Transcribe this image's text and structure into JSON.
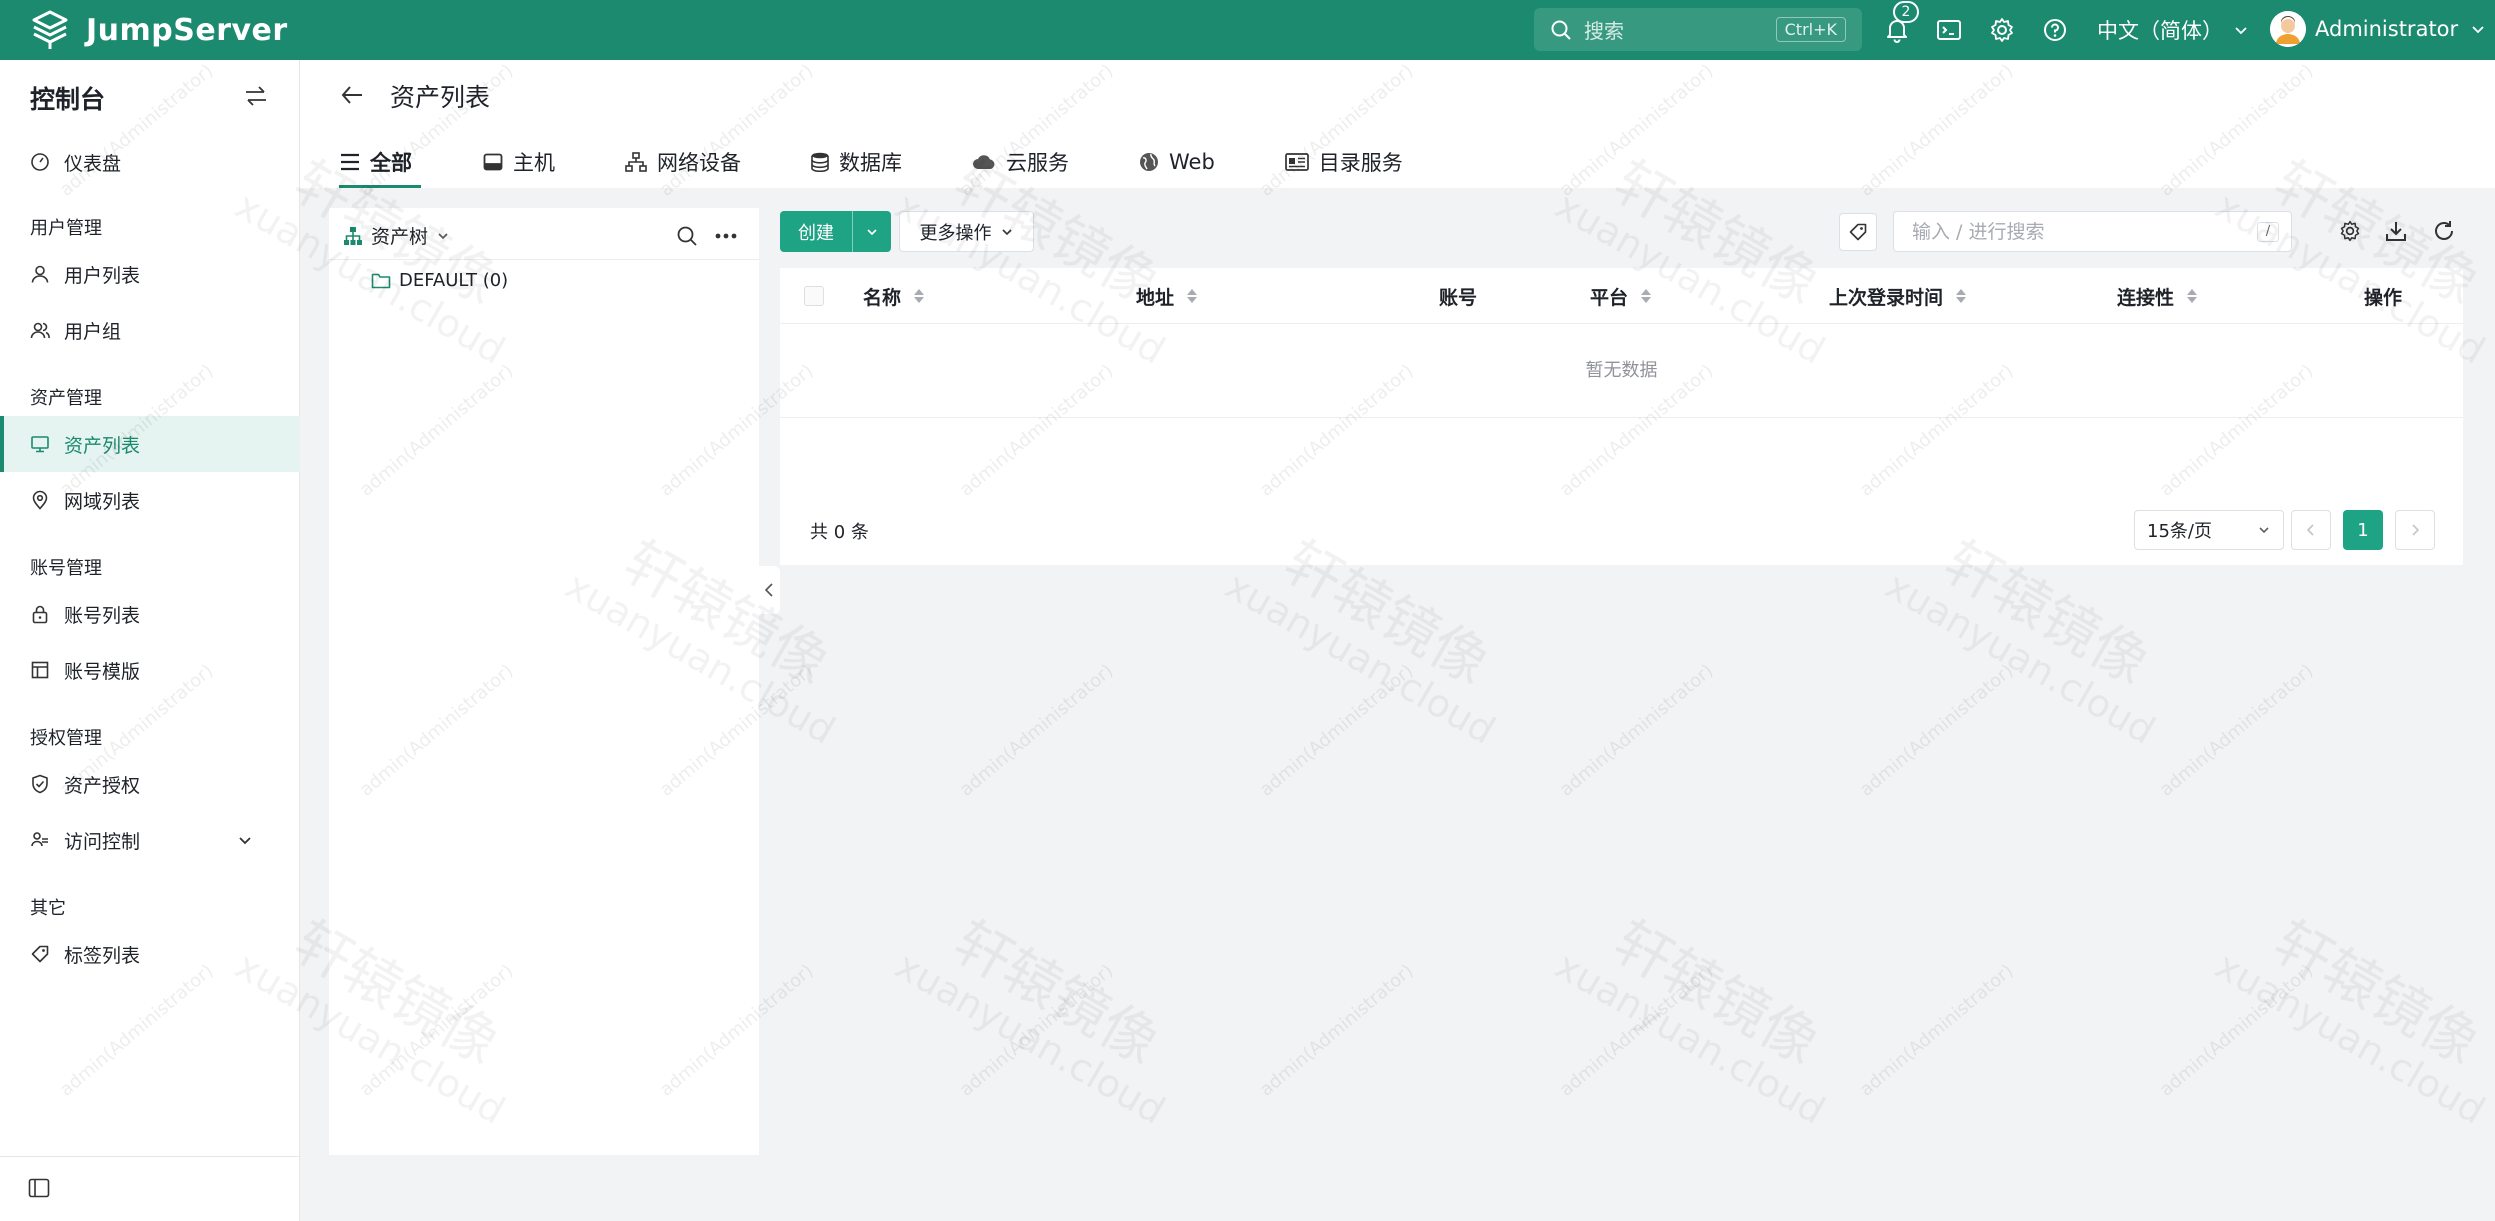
{
  "brand": {
    "name": "JumpServer"
  },
  "topbar": {
    "search_placeholder": "搜索",
    "search_shortcut": "Ctrl+K",
    "notification_count": "2",
    "language": "中文（简体）",
    "user_name": "Administrator"
  },
  "sidebar": {
    "title": "控制台",
    "dashboard": "仪表盘",
    "groups": {
      "user_mgmt": "用户管理",
      "asset_mgmt": "资产管理",
      "account_mgmt": "账号管理",
      "perm_mgmt": "授权管理",
      "other": "其它"
    },
    "items": {
      "user_list": "用户列表",
      "user_group": "用户组",
      "asset_list": "资产列表",
      "zone_list": "网域列表",
      "account_list": "账号列表",
      "account_template": "账号模版",
      "asset_perm": "资产授权",
      "access_control": "访问控制",
      "label_list": "标签列表"
    }
  },
  "page": {
    "title": "资产列表",
    "tabs": [
      "全部",
      "主机",
      "网络设备",
      "数据库",
      "云服务",
      "Web",
      "目录服务"
    ]
  },
  "tree": {
    "title": "资产树",
    "node": "DEFAULT (0)"
  },
  "toolbar": {
    "create": "创建",
    "more_actions": "更多操作",
    "filter_placeholder": "输入 / 进行搜索",
    "filter_key": "/"
  },
  "table": {
    "columns": [
      "名称",
      "地址",
      "账号",
      "平台",
      "上次登录时间",
      "连接性",
      "操作"
    ],
    "empty_text": "暂无数据",
    "total": "共 0 条",
    "page_size": "15条/页",
    "current_page": "1"
  },
  "watermark": {
    "small": "admin(Administrator)",
    "big_cn": "轩辕镜像",
    "big_en": "xuanyuan.cloud"
  },
  "colors": {
    "brand": "#1b8a6f",
    "primary": "#1fa385"
  }
}
